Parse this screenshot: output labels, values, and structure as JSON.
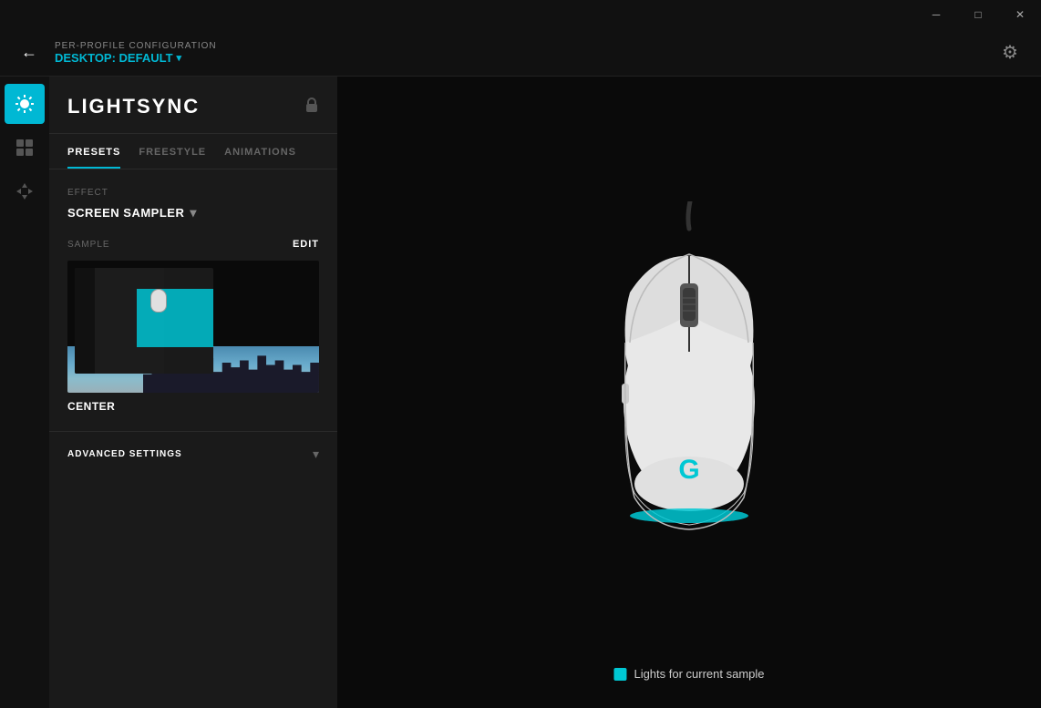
{
  "titlebar": {
    "minimize_label": "─",
    "maximize_label": "□",
    "close_label": "✕"
  },
  "header": {
    "back_icon": "←",
    "config_title": "PER-PROFILE CONFIGURATION",
    "profile_name": "DESKTOP: Default",
    "profile_chevron": "▾",
    "settings_icon": "⚙"
  },
  "icon_sidebar": {
    "lightsync_icon": "✦",
    "add_icon": "+",
    "move_icon": "✥"
  },
  "panel": {
    "title": "LIGHTSYNC",
    "lock_icon": "🔒",
    "tabs": [
      {
        "label": "PRESETS",
        "active": true
      },
      {
        "label": "FREESTYLE",
        "active": false
      },
      {
        "label": "ANIMATIONS",
        "active": false
      }
    ],
    "effect_label": "EFFECT",
    "effect_value": "SCREEN SAMPLER",
    "effect_chevron": "▾",
    "sample_label": "SAMPLE",
    "edit_label": "EDIT",
    "center_label": "CENTER",
    "advanced_label": "ADVANCED SETTINGS",
    "advanced_chevron": "▾"
  },
  "legend": {
    "label": "Lights for current sample",
    "color": "#00c8d4"
  }
}
